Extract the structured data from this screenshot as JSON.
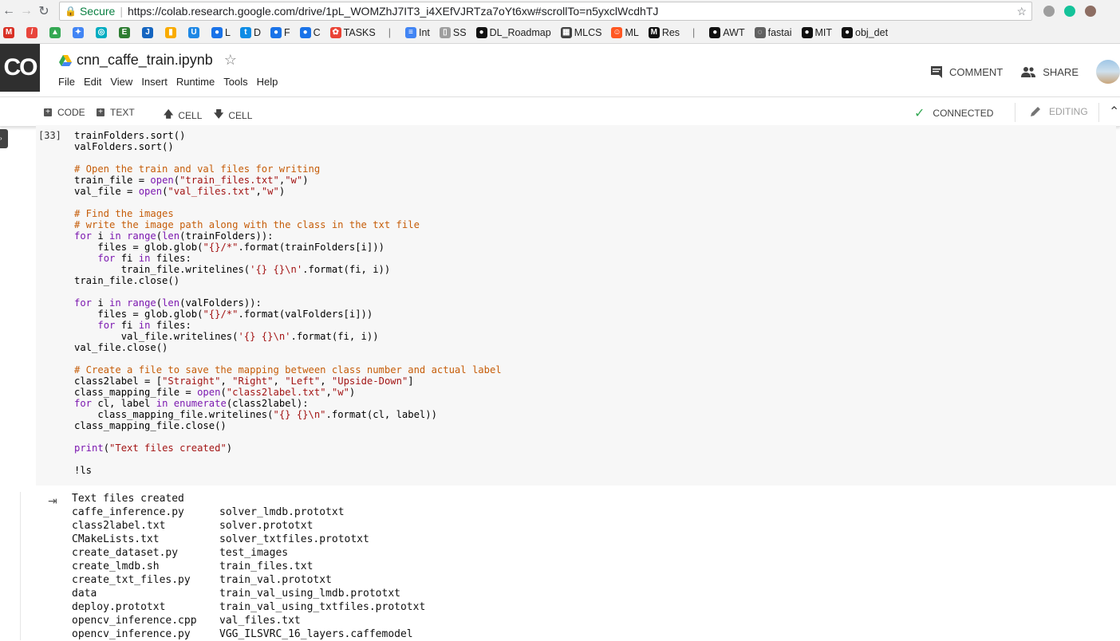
{
  "browser": {
    "secure_label": "Secure",
    "url": "https://colab.research.google.com/drive/1pL_WOMZhJ7IT3_i4XEfVJRTza7oYt6xw#scrollTo=n5yxclWcdhTJ",
    "bookmarks": [
      {
        "label": "",
        "color": "#d93025",
        "glyph": "M"
      },
      {
        "label": "",
        "color": "#e8453c",
        "glyph": "/"
      },
      {
        "label": "",
        "color": "#34a853",
        "glyph": "▲"
      },
      {
        "label": "",
        "color": "#4285f4",
        "glyph": "✦"
      },
      {
        "label": "",
        "color": "#00acc1",
        "glyph": "◎"
      },
      {
        "label": "",
        "color": "#2e7d32",
        "glyph": "E"
      },
      {
        "label": "",
        "color": "#1565c0",
        "glyph": "J"
      },
      {
        "label": "",
        "color": "#f9ab00",
        "glyph": "▮"
      },
      {
        "label": "",
        "color": "#1e88e5",
        "glyph": "U"
      },
      {
        "label": "L",
        "color": "#1a73e8",
        "glyph": "●"
      },
      {
        "label": "D",
        "color": "#0d8ce5",
        "glyph": "t"
      },
      {
        "label": "F",
        "color": "#1a73e8",
        "glyph": "●"
      },
      {
        "label": "C",
        "color": "#1a73e8",
        "glyph": "●"
      },
      {
        "label": "TASKS",
        "color": "#ea4335",
        "glyph": "✿"
      },
      {
        "label": "Int",
        "color": "#4285f4",
        "glyph": "≡"
      },
      {
        "label": "SS",
        "color": "#9e9e9e",
        "glyph": "▯"
      },
      {
        "label": "DL_Roadmap",
        "color": "#111111",
        "glyph": "●"
      },
      {
        "label": "MLCS",
        "color": "#424242",
        "glyph": "▦"
      },
      {
        "label": "ML",
        "color": "#ff5722",
        "glyph": "☺"
      },
      {
        "label": "Res",
        "color": "#111111",
        "glyph": "M"
      },
      {
        "label": "AWT",
        "color": "#111111",
        "glyph": "●"
      },
      {
        "label": "fastai",
        "color": "#616161",
        "glyph": "◌"
      },
      {
        "label": "MIT",
        "color": "#111111",
        "glyph": "●"
      },
      {
        "label": "obj_det",
        "color": "#111111",
        "glyph": "●"
      }
    ]
  },
  "app": {
    "logo": "CO",
    "notebook_title": "cnn_caffe_train.ipynb",
    "menus": [
      "File",
      "Edit",
      "View",
      "Insert",
      "Runtime",
      "Tools",
      "Help"
    ],
    "comment_label": "COMMENT",
    "share_label": "SHARE"
  },
  "toolbar": {
    "code_label": "CODE",
    "text_label": "TEXT",
    "cell_up_label": "CELL",
    "cell_down_label": "CELL",
    "status_label": "CONNECTED",
    "editing_label": "EDITING"
  },
  "cell": {
    "exec_count": "[33]",
    "code_lines": [
      [
        [
          "n",
          "trainFolders.sort()"
        ]
      ],
      [
        [
          "n",
          "valFolders.sort()"
        ]
      ],
      [],
      [
        [
          "c",
          "# Open the train and val files for writing"
        ]
      ],
      [
        [
          "n",
          "train_file = "
        ],
        [
          "k",
          "open"
        ],
        [
          "n",
          "("
        ],
        [
          "s",
          "\"train_files.txt\""
        ],
        [
          "n",
          ","
        ],
        [
          "s",
          "\"w\""
        ],
        [
          "n",
          ")"
        ]
      ],
      [
        [
          "n",
          "val_file = "
        ],
        [
          "k",
          "open"
        ],
        [
          "n",
          "("
        ],
        [
          "s",
          "\"val_files.txt\""
        ],
        [
          "n",
          ","
        ],
        [
          "s",
          "\"w\""
        ],
        [
          "n",
          ")"
        ]
      ],
      [],
      [
        [
          "c",
          "# Find the images"
        ]
      ],
      [
        [
          "c",
          "# write the image path along with the class in the txt file"
        ]
      ],
      [
        [
          "k",
          "for"
        ],
        [
          "n",
          " i "
        ],
        [
          "k",
          "in"
        ],
        [
          "n",
          " "
        ],
        [
          "k",
          "range"
        ],
        [
          "n",
          "("
        ],
        [
          "k",
          "len"
        ],
        [
          "n",
          "(trainFolders)):"
        ]
      ],
      [
        [
          "n",
          "    files = glob.glob("
        ],
        [
          "s",
          "\"{}/*\""
        ],
        [
          "n",
          ".format(trainFolders[i]))"
        ]
      ],
      [
        [
          "n",
          "    "
        ],
        [
          "k",
          "for"
        ],
        [
          "n",
          " fi "
        ],
        [
          "k",
          "in"
        ],
        [
          "n",
          " files:"
        ]
      ],
      [
        [
          "n",
          "        train_file.writelines("
        ],
        [
          "s",
          "'{} {}\\n'"
        ],
        [
          "n",
          ".format(fi, i))"
        ]
      ],
      [
        [
          "n",
          "train_file.close()"
        ]
      ],
      [],
      [
        [
          "k",
          "for"
        ],
        [
          "n",
          " i "
        ],
        [
          "k",
          "in"
        ],
        [
          "n",
          " "
        ],
        [
          "k",
          "range"
        ],
        [
          "n",
          "("
        ],
        [
          "k",
          "len"
        ],
        [
          "n",
          "(valFolders)):"
        ]
      ],
      [
        [
          "n",
          "    files = glob.glob("
        ],
        [
          "s",
          "\"{}/*\""
        ],
        [
          "n",
          ".format(valFolders[i]))"
        ]
      ],
      [
        [
          "n",
          "    "
        ],
        [
          "k",
          "for"
        ],
        [
          "n",
          " fi "
        ],
        [
          "k",
          "in"
        ],
        [
          "n",
          " files:"
        ]
      ],
      [
        [
          "n",
          "        val_file.writelines("
        ],
        [
          "s",
          "'{} {}\\n'"
        ],
        [
          "n",
          ".format(fi, i))"
        ]
      ],
      [
        [
          "n",
          "val_file.close()"
        ]
      ],
      [],
      [
        [
          "c",
          "# Create a file to save the mapping between class number and actual label"
        ]
      ],
      [
        [
          "n",
          "class2label = ["
        ],
        [
          "s",
          "\"Straight\""
        ],
        [
          "n",
          ", "
        ],
        [
          "s",
          "\"Right\""
        ],
        [
          "n",
          ", "
        ],
        [
          "s",
          "\"Left\""
        ],
        [
          "n",
          ", "
        ],
        [
          "s",
          "\"Upside-Down\""
        ],
        [
          "n",
          "]"
        ]
      ],
      [
        [
          "n",
          "class_mapping_file = "
        ],
        [
          "k",
          "open"
        ],
        [
          "n",
          "("
        ],
        [
          "s",
          "\"class2label.txt\""
        ],
        [
          "n",
          ","
        ],
        [
          "s",
          "\"w\""
        ],
        [
          "n",
          ")"
        ]
      ],
      [
        [
          "k",
          "for"
        ],
        [
          "n",
          " cl, label "
        ],
        [
          "k",
          "in"
        ],
        [
          "n",
          " "
        ],
        [
          "k",
          "enumerate"
        ],
        [
          "n",
          "(class2label):"
        ]
      ],
      [
        [
          "n",
          "    class_mapping_file.writelines("
        ],
        [
          "s",
          "\"{} {}\\n\""
        ],
        [
          "n",
          ".format(cl, label))"
        ]
      ],
      [
        [
          "n",
          "class_mapping_file.close()"
        ]
      ],
      [],
      [
        [
          "k",
          "print"
        ],
        [
          "n",
          "("
        ],
        [
          "s",
          "\"Text files created\""
        ],
        [
          "n",
          ")"
        ]
      ],
      [],
      [
        [
          "n",
          "!ls"
        ]
      ]
    ]
  },
  "output": {
    "first_line": "Text files created",
    "rows": [
      [
        "caffe_inference.py",
        "solver_lmdb.prototxt"
      ],
      [
        "class2label.txt",
        "solver.prototxt"
      ],
      [
        "CMakeLists.txt",
        "solver_txtfiles.prototxt"
      ],
      [
        "create_dataset.py",
        "test_images"
      ],
      [
        "create_lmdb.sh",
        "train_files.txt"
      ],
      [
        "create_txt_files.py",
        "train_val.prototxt"
      ],
      [
        "data",
        "train_val_using_lmdb.prototxt"
      ],
      [
        "deploy.prototxt",
        "train_val_using_txtfiles.prototxt"
      ],
      [
        "opencv_inference.cpp",
        "val_files.txt"
      ],
      [
        "opencv_inference.py",
        "VGG_ILSVRC_16_layers.caffemodel"
      ]
    ]
  }
}
